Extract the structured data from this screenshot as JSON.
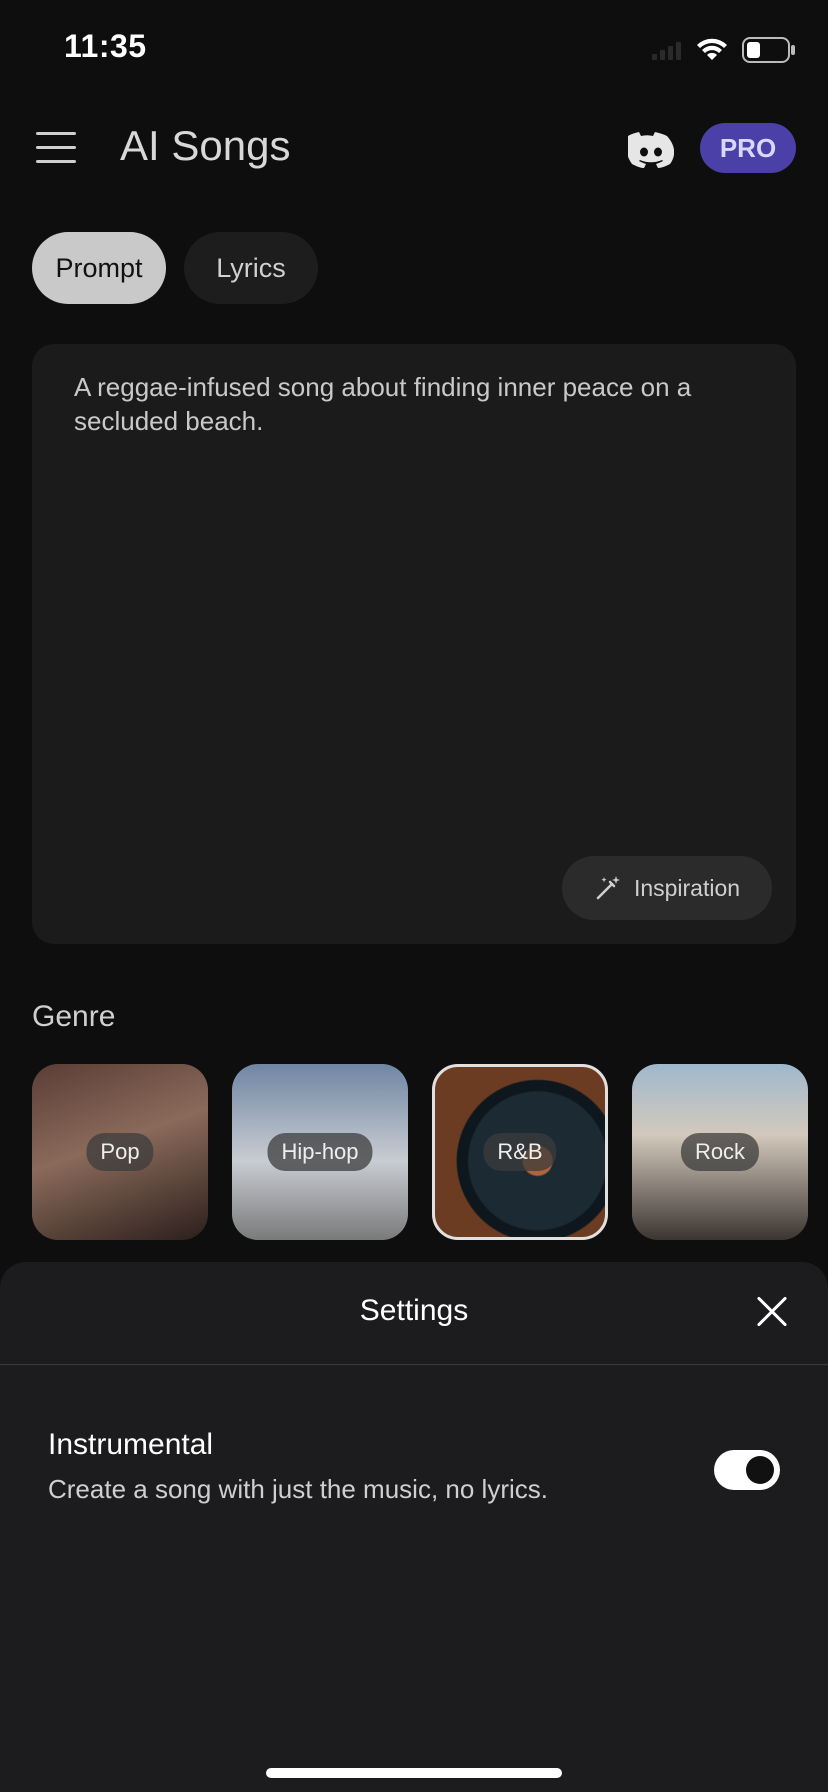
{
  "status_bar": {
    "time": "11:35",
    "battery_level": 0.35
  },
  "header": {
    "title": "AI Songs",
    "pro_label": "PRO"
  },
  "tabs": [
    {
      "label": "Prompt",
      "active": true
    },
    {
      "label": "Lyrics",
      "active": false
    }
  ],
  "prompt": {
    "text": "A reggae-infused song about finding inner peace on a secluded beach.",
    "inspiration_label": "Inspiration"
  },
  "genre": {
    "title": "Genre",
    "items": [
      {
        "label": "Pop",
        "selected": false
      },
      {
        "label": "Hip-hop",
        "selected": false
      },
      {
        "label": "R&B",
        "selected": true
      },
      {
        "label": "Rock",
        "selected": false
      }
    ]
  },
  "settings_sheet": {
    "title": "Settings",
    "instrumental": {
      "title": "Instrumental",
      "description": "Create a song with just the music, no lyrics.",
      "enabled": true
    }
  },
  "icons": [
    "menu-icon",
    "discord-icon",
    "magic-wand-icon",
    "close-icon",
    "signal-icon",
    "wifi-icon",
    "battery-icon"
  ],
  "colors": {
    "accent": "#4b3fa8",
    "background": "#0e0e0e",
    "sheet": "#1c1c1e"
  }
}
